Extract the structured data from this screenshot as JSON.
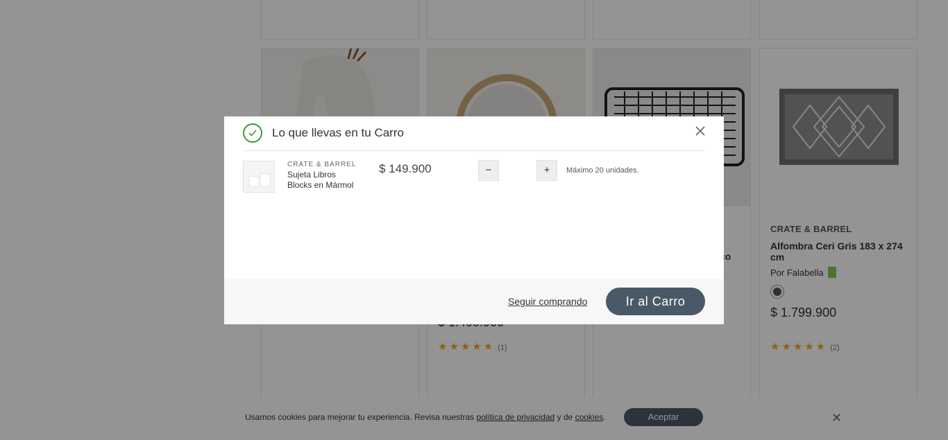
{
  "background": {
    "cards": [
      {
        "brand": "",
        "name": "",
        "price": "",
        "stars": "",
        "reviews": ""
      },
      {
        "brand": "",
        "name": "",
        "price": "$ 1.499.900",
        "stars": "★★★★★",
        "reviews": "(1)"
      },
      {
        "brand": "",
        "name": "co",
        "price": "",
        "stars": "",
        "reviews": ""
      },
      {
        "brand": "CRATE & BARREL",
        "name": "Alfombra Ceri Gris 183 x 274 cm",
        "seller": "Por Falabella",
        "price": "$ 1.799.900",
        "stars": "★★★★★",
        "reviews": "(2)"
      }
    ]
  },
  "modal": {
    "title": "Lo que llevas en tu Carro",
    "item": {
      "brand": "CRATE & BARREL",
      "name_line1": "Sujeta Libros",
      "name_line2": "Blocks en Mármol",
      "price": "$ 149.900",
      "minus": "−",
      "plus": "+",
      "note": "Máximo 20 unidades."
    },
    "keep_shopping": "Seguir comprando",
    "go_cart": "Ir al Carro"
  },
  "cookie": {
    "text_before": "Usamos cookies para mejorar tu experiencia. Revisa nuestras ",
    "privacy_link": "política de privacidad",
    "text_mid": " y de ",
    "cookies_link": "cookies",
    "text_after": ".",
    "accept": "Aceptar",
    "close": "✕"
  },
  "colors": {
    "accent": "#4a5968",
    "success": "#3a9b3a",
    "stars": "#f5a623",
    "seller_badge": "#8bc34a"
  }
}
